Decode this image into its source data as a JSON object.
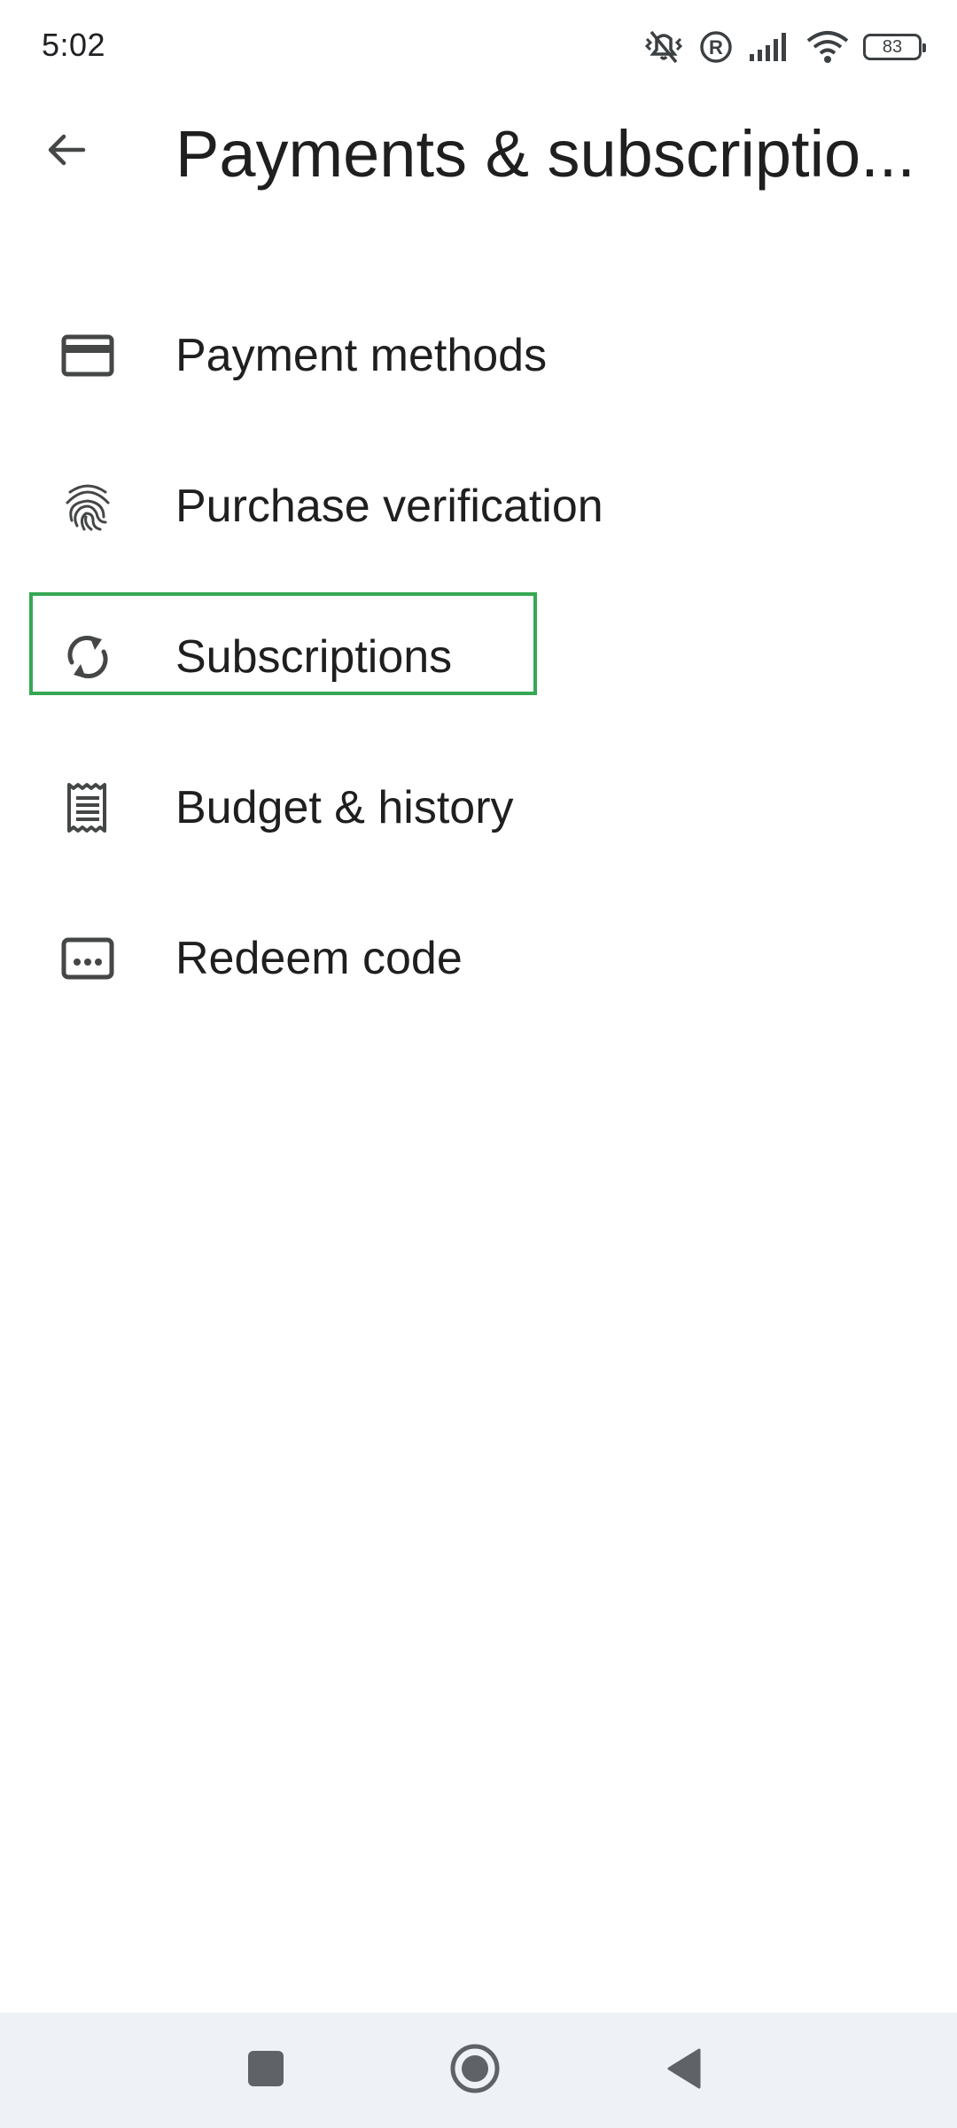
{
  "status_bar": {
    "time": "5:02",
    "battery_level": "83",
    "icons": [
      "vibrate-off-icon",
      "registered-icon",
      "signal-icon",
      "wifi-icon",
      "battery-icon"
    ]
  },
  "app_bar": {
    "title": "Payments & subscriptio...",
    "back_icon": "arrow-back-icon"
  },
  "menu": {
    "items": [
      {
        "label": "Payment methods",
        "icon": "credit-card-icon"
      },
      {
        "label": "Purchase verification",
        "icon": "fingerprint-icon"
      },
      {
        "label": "Subscriptions",
        "icon": "sync-icon"
      },
      {
        "label": "Budget & history",
        "icon": "receipt-icon"
      },
      {
        "label": "Redeem code",
        "icon": "redeem-code-icon"
      }
    ]
  },
  "highlight": {
    "target": "Subscriptions",
    "color": "#34a853"
  },
  "nav_bar": {
    "buttons": [
      "recents-square-icon",
      "home-circle-icon",
      "back-triangle-icon"
    ]
  },
  "colors": {
    "text_primary": "#1f1f1f",
    "icon": "#444746",
    "nav_background": "#eef2f7"
  }
}
